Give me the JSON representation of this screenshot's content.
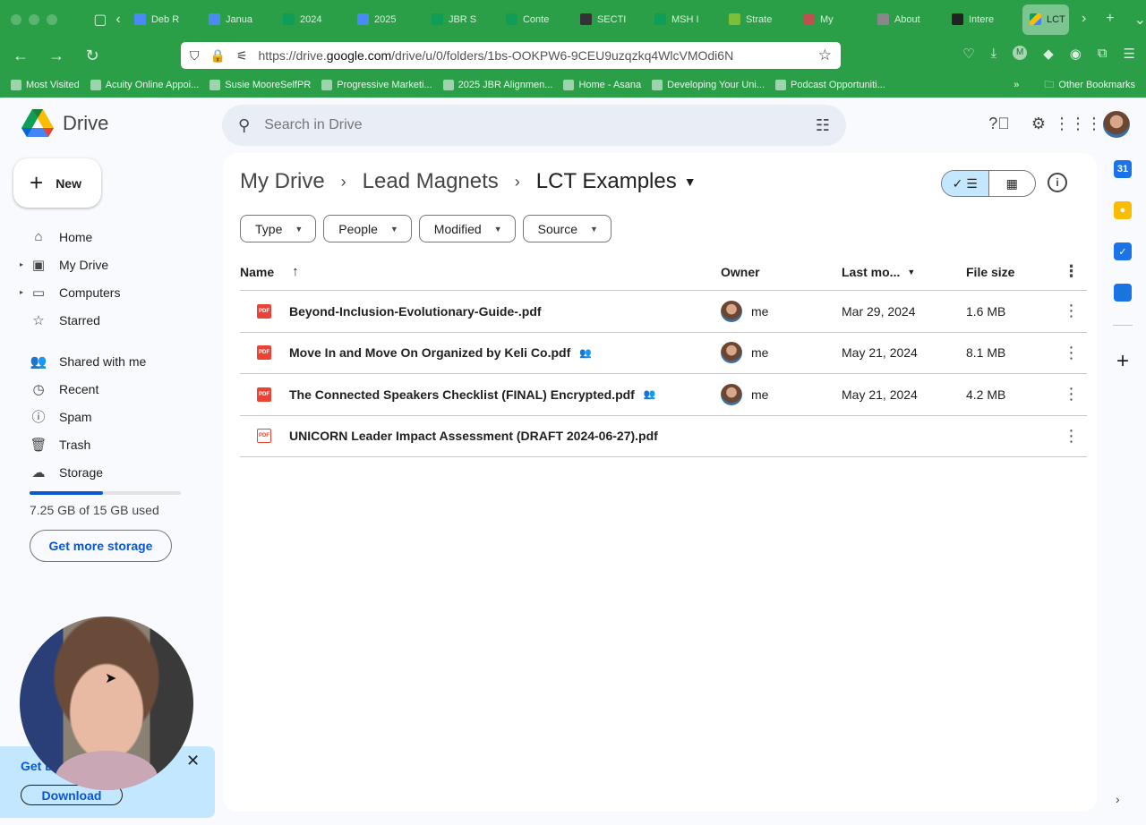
{
  "browser": {
    "tabs": [
      {
        "label": "Deb R",
        "color": "#4a8af4"
      },
      {
        "label": "Janua",
        "color": "#4a8af4"
      },
      {
        "label": "2024",
        "color": "#0f9d58"
      },
      {
        "label": "2025",
        "color": "#4a8af4"
      },
      {
        "label": "JBR S",
        "color": "#0f9d58"
      },
      {
        "label": "Conte",
        "color": "#0f9d58"
      },
      {
        "label": "SECTI",
        "color": "#333333"
      },
      {
        "label": "MSH I",
        "color": "#0f9d58"
      },
      {
        "label": "Strate",
        "color": "#7bbf3a"
      },
      {
        "label": "My",
        "color": "#c0504d"
      },
      {
        "label": "About",
        "color": "#888888"
      },
      {
        "label": "Intere",
        "color": "#222222"
      }
    ],
    "active_tab": {
      "label": "LCT"
    },
    "url_prefix": "https://drive.",
    "url_domain": "google.com",
    "url_rest": "/drive/u/0/folders/1bs-OOKPW6-9CEU9uzqzkq4WlcVMOdi6N",
    "bookmarks": [
      "Most Visited",
      "Acuity Online Appoi...",
      "Susie MooreSelfPR",
      "Progressive Marketi...",
      "2025 JBR Alignmen...",
      "Home - Asana",
      "Developing Your Uni...",
      "Podcast Opportuniti..."
    ],
    "other_bookmarks": "Other Bookmarks",
    "profile_letter": "M"
  },
  "drive": {
    "brand": "Drive",
    "search_placeholder": "Search in Drive",
    "new_label": "New",
    "nav": [
      {
        "label": "Home",
        "icon": "home-icon",
        "glyph": "⌂",
        "caret": false
      },
      {
        "label": "My Drive",
        "icon": "my-drive-icon",
        "glyph": "▣",
        "caret": true
      },
      {
        "label": "Computers",
        "icon": "computers-icon",
        "glyph": "▭",
        "caret": true
      },
      {
        "label": "Starred",
        "icon": "star-icon",
        "glyph": "☆",
        "caret": false
      }
    ],
    "nav2": [
      {
        "label": "Shared with me",
        "icon": "shared-icon",
        "glyph": "👥"
      },
      {
        "label": "Recent",
        "icon": "clock-icon",
        "glyph": "◷"
      },
      {
        "label": "Spam",
        "icon": "spam-icon",
        "glyph": "ⓘ"
      },
      {
        "label": "Trash",
        "icon": "trash-icon",
        "glyph": "🗑"
      },
      {
        "label": "Storage",
        "icon": "cloud-icon",
        "glyph": "☁"
      }
    ],
    "storage_used_fraction": 0.483,
    "storage_text": "7.25 GB of 15 GB used",
    "get_more_storage": "Get more storage",
    "breadcrumb": [
      "My Drive",
      "Lead Magnets",
      "LCT Examples"
    ],
    "filters": [
      "Type",
      "People",
      "Modified",
      "Source"
    ],
    "columns": {
      "name": "Name",
      "owner": "Owner",
      "modified": "Last mo...",
      "size": "File size"
    },
    "files": [
      {
        "name": "Beyond-Inclusion-Evolutionary-Guide-.pdf",
        "shared": false,
        "owner": "me",
        "modified": "Mar 29, 2024",
        "size": "1.6 MB",
        "uploading": false
      },
      {
        "name": "Move In and Move On Organized by Keli Co.pdf",
        "shared": true,
        "owner": "me",
        "modified": "May 21, 2024",
        "size": "8.1 MB",
        "uploading": false
      },
      {
        "name": "The Connected Speakers Checklist (FINAL) Encrypted.pdf",
        "shared": true,
        "owner": "me",
        "modified": "May 21, 2024",
        "size": "4.2 MB",
        "uploading": false
      },
      {
        "name": "UNICORN Leader Impact Assessment (DRAFT 2024-06-27).pdf",
        "shared": false,
        "owner": "",
        "modified": "",
        "size": "",
        "uploading": true
      }
    ],
    "pdf_label": "PDF",
    "rail": [
      {
        "icon": "calendar-icon",
        "color": "#1a73e8",
        "glyph": "31"
      },
      {
        "icon": "keep-icon",
        "color": "#fbbc04",
        "glyph": "●"
      },
      {
        "icon": "tasks-icon",
        "color": "#1a73e8",
        "glyph": "✓"
      },
      {
        "icon": "contacts-icon",
        "color": "#1a73e8",
        "glyph": "👤"
      }
    ]
  },
  "promo": {
    "title": "Get D",
    "download_label": "Download"
  }
}
